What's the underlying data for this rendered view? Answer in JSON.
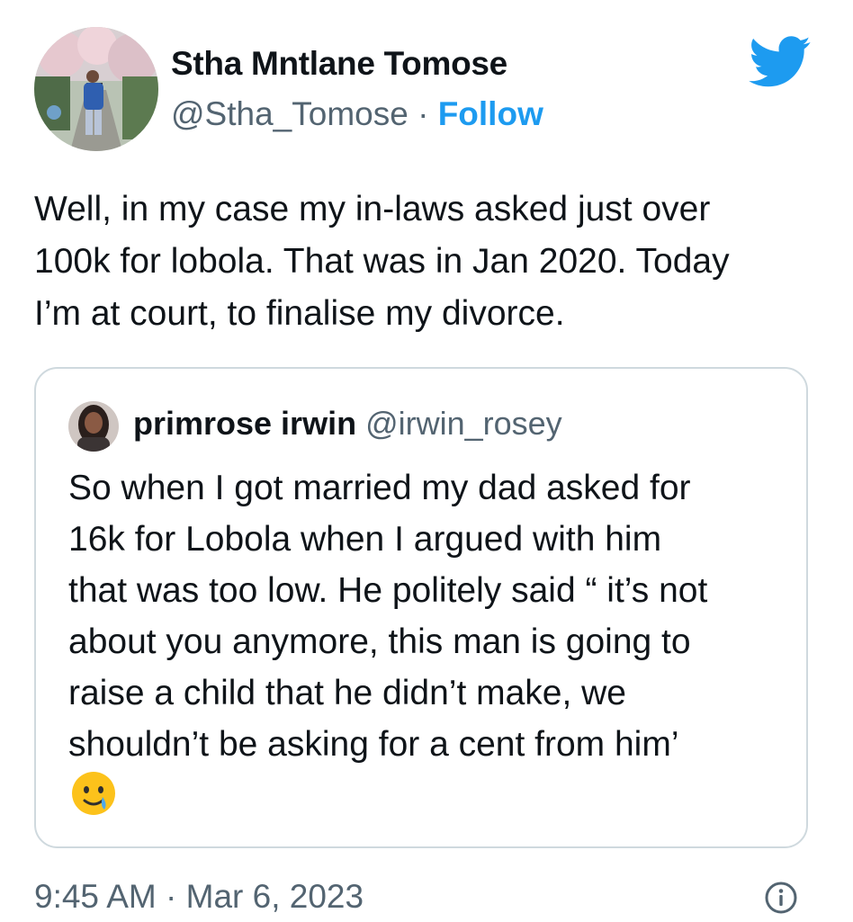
{
  "author": {
    "name": "Stha Mntlane Tomose",
    "handle": "@Stha_Tomose",
    "separator": "·",
    "follow_label": "Follow",
    "avatar_icon": "profile-photo-avatar"
  },
  "brand": {
    "icon": "twitter-bird-icon",
    "color": "#1d9bf0"
  },
  "tweet": {
    "lines": [
      "Well, in my case my in-laws asked just over",
      "100k for lobola. That was in Jan 2020. Today",
      "I’m at court, to finalise my divorce."
    ]
  },
  "quoted": {
    "name": "primrose irwin",
    "handle": "@irwin_rosey",
    "avatar_icon": "profile-photo-avatar",
    "lines": [
      "So when I got married my dad asked for",
      "16k for Lobola when I argued with him",
      "that was too low. He politely said “ it’s not",
      "about you anymore, this man is going to",
      "raise a child that he didn’t make, we",
      "shouldn’t be asking for a cent from him’"
    ],
    "emoji_icon": "face-holding-back-tears-emoji"
  },
  "meta": {
    "timestamp": "9:45 AM · Mar 6, 2023",
    "info_icon": "info-icon"
  },
  "colors": {
    "text": "#0f1419",
    "secondary": "#536471",
    "accent": "#1d9bf0",
    "border": "#cfd9de"
  }
}
